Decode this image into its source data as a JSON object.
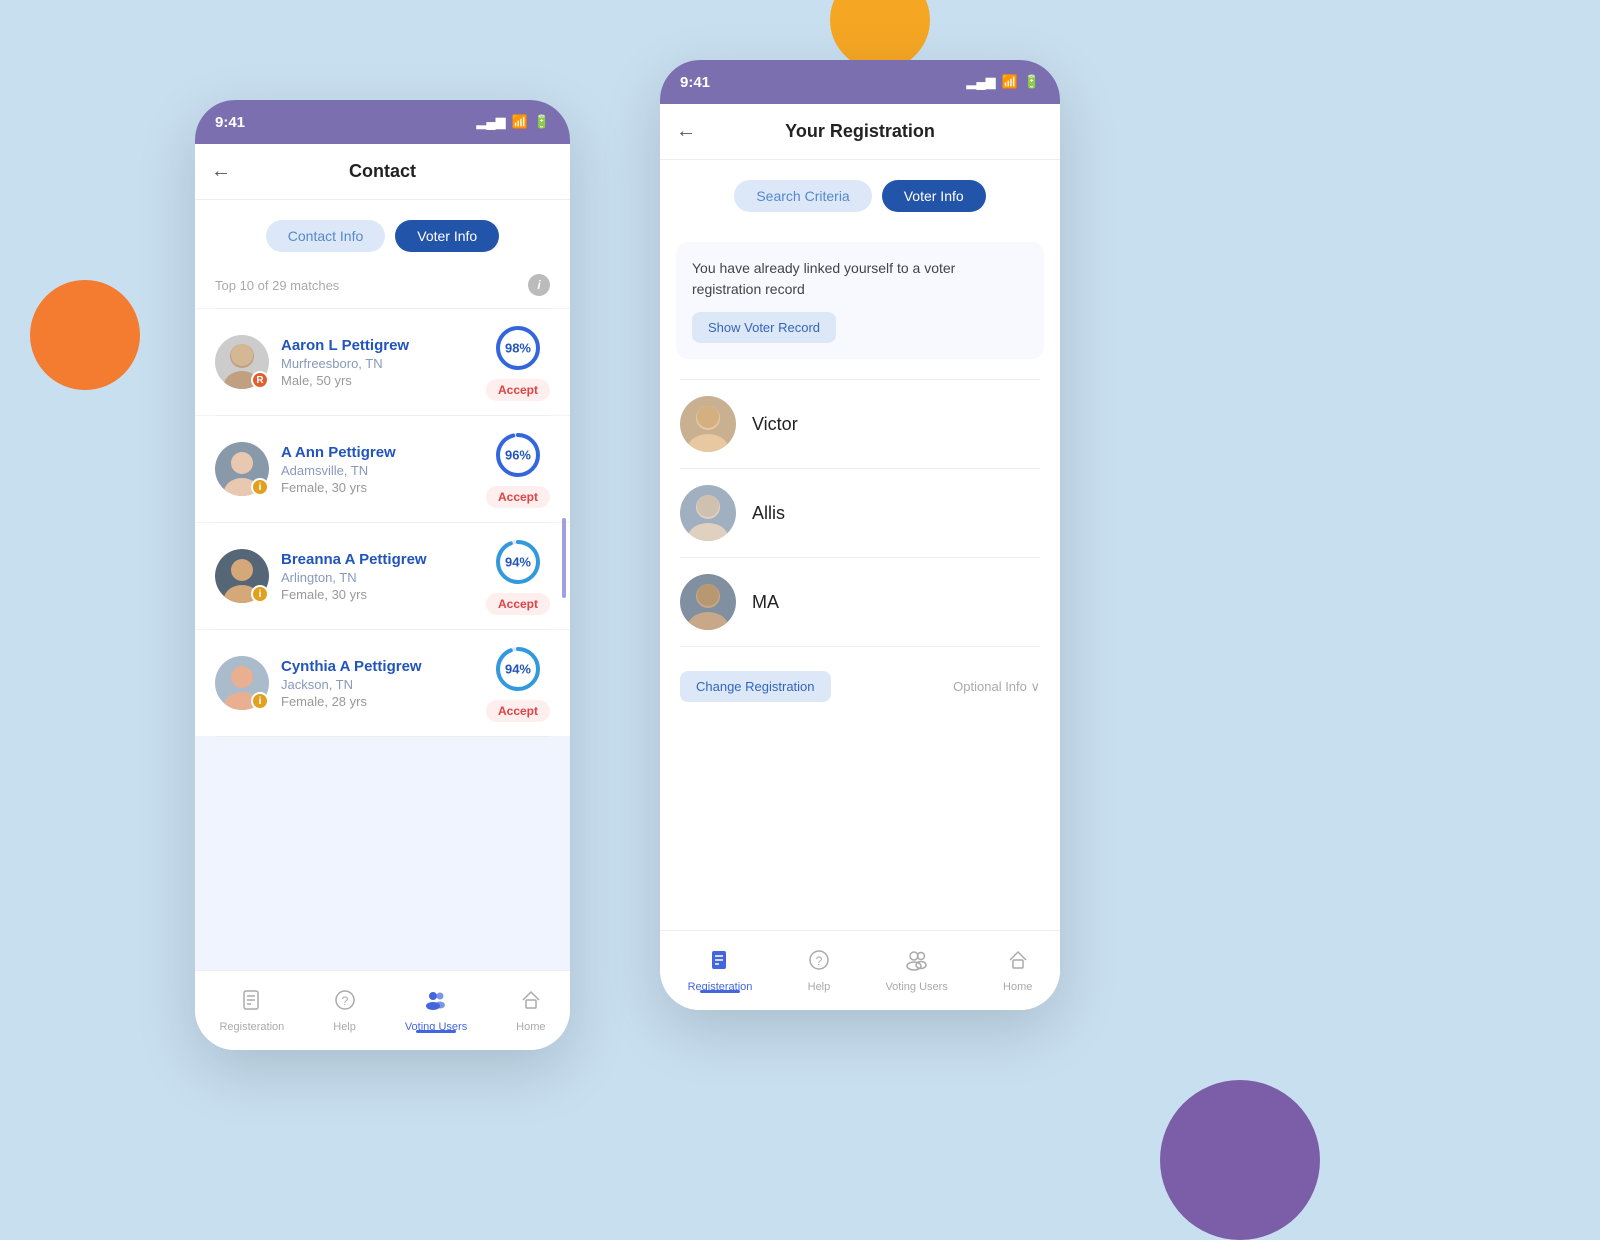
{
  "background_color": "#c8dff0",
  "left_phone": {
    "status_bar": {
      "time": "9:41",
      "signal": "▂▄▆",
      "wifi": "WiFi",
      "battery": "Battery"
    },
    "header": {
      "back_label": "←",
      "title": "Contact"
    },
    "tabs": [
      {
        "label": "Contact Info",
        "state": "inactive"
      },
      {
        "label": "Voter Info",
        "state": "active"
      }
    ],
    "match_info": "Top 10 of 29 matches",
    "contacts": [
      {
        "name": "Aaron L Pettigrew",
        "location": "Murfreesboro, TN",
        "details": "Male, 50 yrs",
        "badge": "R",
        "badge_class": "badge-r",
        "percent": 98,
        "accept_label": "Accept"
      },
      {
        "name": "A Ann Pettigrew",
        "location": "Adamsville, TN",
        "details": "Female, 30 yrs",
        "badge": "i",
        "badge_class": "badge-i",
        "percent": 96,
        "accept_label": "Accept"
      },
      {
        "name": "Breanna A Pettigrew",
        "location": "Arlington, TN",
        "details": "Female, 30 yrs",
        "badge": "i",
        "badge_class": "badge-i",
        "percent": 94,
        "accept_label": "Accept"
      },
      {
        "name": "Cynthia A Pettigrew",
        "location": "Jackson, TN",
        "details": "Female, 28 yrs",
        "badge": "i",
        "badge_class": "badge-i",
        "percent": 94,
        "accept_label": "Accept"
      }
    ],
    "bottom_nav": [
      {
        "label": "Registeration",
        "icon": "📄",
        "active": false
      },
      {
        "label": "Help",
        "icon": "❓",
        "active": false
      },
      {
        "label": "Voting Users",
        "icon": "👥",
        "active": true
      },
      {
        "label": "Home",
        "icon": "🏠",
        "active": false
      }
    ]
  },
  "right_phone": {
    "status_bar": {
      "time": "9:41",
      "signal": "▂▄▆",
      "wifi": "WiFi",
      "battery": "Battery"
    },
    "header": {
      "back_label": "←",
      "title": "Your Registration"
    },
    "tabs": [
      {
        "label": "Search Criteria",
        "state": "inactive"
      },
      {
        "label": "Voter Info",
        "state": "active"
      }
    ],
    "message": "You have already linked yourself to a voter registration record",
    "show_voter_btn": "Show Voter Record",
    "persons": [
      {
        "name": "Victor",
        "avatar_color": "#b09070"
      },
      {
        "name": "Allis",
        "avatar_color": "#a0b0c0"
      },
      {
        "name": "MA",
        "avatar_color": "#a08070"
      }
    ],
    "change_reg_btn": "Change Registration",
    "optional_info": "Optional Info ∨",
    "bottom_nav": [
      {
        "label": "Registeration",
        "icon": "📄",
        "active": true
      },
      {
        "label": "Help",
        "icon": "❓",
        "active": false
      },
      {
        "label": "Voting Users",
        "icon": "👥",
        "active": false
      },
      {
        "label": "Home",
        "icon": "🏠",
        "active": false
      }
    ]
  }
}
